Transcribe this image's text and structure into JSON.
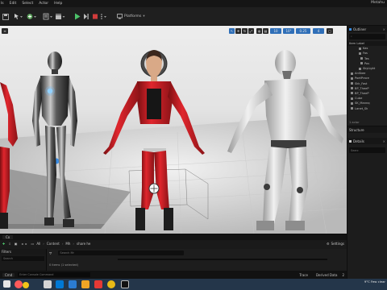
{
  "menu": {
    "items": [
      "ls",
      "Edit",
      "Select",
      "Actor",
      "Help"
    ],
    "project_title": "Metahu"
  },
  "toolbar": {
    "platforms_label": "Platforms"
  },
  "viewport": {
    "grid_snap_value": "10",
    "rotation_snap_value": "10°",
    "scale_snap_value": "0.25",
    "camera_speed_value": "4"
  },
  "outliner": {
    "title": "Outliner",
    "column_label": "Item Label",
    "items": [
      "Kas",
      "Fas",
      "Tes",
      "Pos",
      "SkyLight",
      "AnSkee",
      "PoetPrace",
      "Skk_Fast",
      "BP_TheeP",
      "BP_TheeP",
      "Cube",
      "SK_Mannq",
      "Lanet_Sk"
    ],
    "count_text": "1 actor"
  },
  "details": {
    "panel_a_title": "Structure",
    "panel_b_title": "Details",
    "search_placeholder": "Searc"
  },
  "content_browser": {
    "tab_label": "Co",
    "breadcrumbs": [
      "All",
      "Content",
      "Mh",
      "share he"
    ],
    "settings_label": "Settings",
    "filters_label": "Filters",
    "search_placeholder": "Search",
    "asset_search_placeholder": "Search Mr",
    "items_count": "0 items (1 selected)"
  },
  "statusbar": {
    "cmd_label": "Cmd",
    "console_placeholder": "Enter Console Command",
    "trace_label": "Trace",
    "derived_data_label": "Derived Data",
    "source_control_label": "2"
  },
  "taskbar": {
    "weather_temp": "9°C",
    "weather_desc": "Few clear",
    "time": "11:34 AM",
    "date": "3/19/2024"
  },
  "colors": {
    "accent": "#3a8ee6",
    "play_green": "#4cc26a",
    "selection": "#1f4e80",
    "taskbar": "#24364a"
  }
}
